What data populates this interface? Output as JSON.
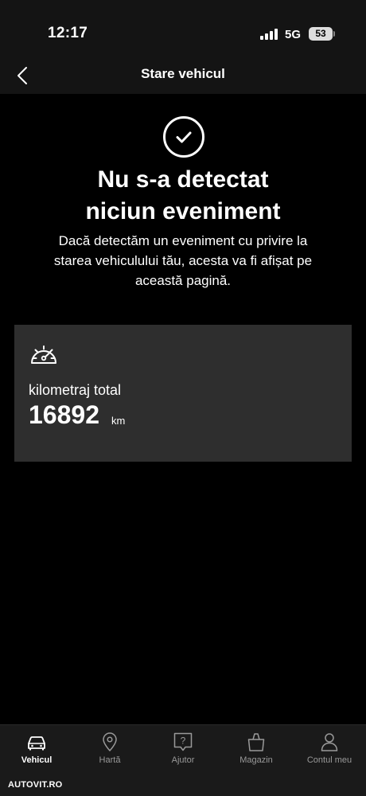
{
  "status_bar": {
    "time": "12:17",
    "network": "5G",
    "battery": "53"
  },
  "header": {
    "title": "Stare vehicul",
    "back_icon": "chevron-left-icon"
  },
  "event_status": {
    "icon": "check-circle-icon",
    "headline_line1": "Nu s-a detectat",
    "headline_line2": "niciun eveniment",
    "description_line1": "Dacă detectăm un eveniment cu privire la",
    "description_line2": "starea vehiculului tău, acesta va fi afișat pe",
    "description_line3": "această pagină."
  },
  "odometer": {
    "icon": "speedometer-icon",
    "label": "kilometraj total",
    "value": "16892",
    "unit": "km"
  },
  "tabs": [
    {
      "label": "Vehicul",
      "icon": "car-icon",
      "active": true
    },
    {
      "label": "Hartă",
      "icon": "map-pin-icon",
      "active": false
    },
    {
      "label": "Ajutor",
      "icon": "help-icon",
      "active": false
    },
    {
      "label": "Magazin",
      "icon": "shopping-bag-icon",
      "active": false
    },
    {
      "label": "Contul meu",
      "icon": "user-icon",
      "active": false
    }
  ],
  "watermark": "AUTOVIT.RO"
}
